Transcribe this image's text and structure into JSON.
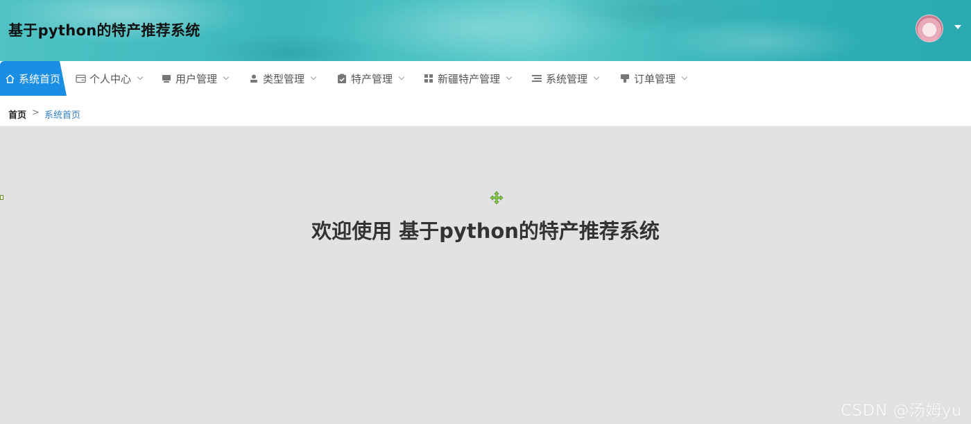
{
  "header": {
    "title": "基于python的特产推荐系统",
    "avatar_icon": "user-avatar"
  },
  "nav": {
    "items": [
      {
        "label": "系统首页",
        "icon": "home-icon"
      },
      {
        "label": "个人中心",
        "icon": "wallet-icon"
      },
      {
        "label": "用户管理",
        "icon": "user-card-icon"
      },
      {
        "label": "类型管理",
        "icon": "person-icon"
      },
      {
        "label": "特产管理",
        "icon": "clipboard-check-icon"
      },
      {
        "label": "新疆特产管理",
        "icon": "grid-icon"
      },
      {
        "label": "系统管理",
        "icon": "list-icon"
      },
      {
        "label": "订单管理",
        "icon": "stamp-icon"
      }
    ],
    "active_color": "#1a8ee3"
  },
  "breadcrumb": {
    "home": "首页",
    "separator": ">",
    "current": "系统首页"
  },
  "main": {
    "welcome": "欢迎使用 基于python的特产推荐系统"
  },
  "watermark": "CSDN @汤姆yu"
}
